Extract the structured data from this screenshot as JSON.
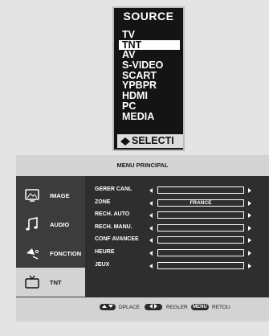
{
  "source_menu": {
    "title": "SOURCE",
    "items": [
      {
        "label": "TV",
        "selected": false
      },
      {
        "label": "TNT",
        "selected": true
      },
      {
        "label": "AV",
        "selected": false
      },
      {
        "label": "S-VIDEO",
        "selected": false
      },
      {
        "label": "SCART",
        "selected": false
      },
      {
        "label": "YPBPR",
        "selected": false
      },
      {
        "label": "HDMI",
        "selected": false
      },
      {
        "label": "PC",
        "selected": false
      },
      {
        "label": "MEDIA",
        "selected": false
      }
    ],
    "select_label": "SELECTI"
  },
  "main_menu": {
    "title": "MENU PRINCIPAL",
    "sidebar": [
      {
        "label": "IMAGE",
        "icon": "image-icon",
        "active": false
      },
      {
        "label": "AUDIO",
        "icon": "music-note-icon",
        "active": false
      },
      {
        "label": "FONCTION",
        "icon": "function-icon",
        "active": false
      },
      {
        "label": "TNT",
        "icon": "tv-icon",
        "active": true
      }
    ],
    "rows": [
      {
        "label": "GERER CANL",
        "value": ""
      },
      {
        "label": "ZONE",
        "value": "FRANCE"
      },
      {
        "label": "RECH. AUTO",
        "value": ""
      },
      {
        "label": "RECH. MANU.",
        "value": ""
      },
      {
        "label": "CONF AVANCEE",
        "value": ""
      },
      {
        "label": "HEURE",
        "value": ""
      },
      {
        "label": "JEUX",
        "value": ""
      }
    ]
  },
  "hint_bar": {
    "move_label": "DPLACE",
    "adjust_label": "REGLER",
    "menu_key": "MENU",
    "back_label": "RETOU"
  },
  "colors": {
    "background": "#e4e4e4",
    "source_bg": "#141414",
    "menu_panel": "#d3d3d3",
    "menu_body": "#2e2e2e",
    "text_light": "#ffffff"
  }
}
